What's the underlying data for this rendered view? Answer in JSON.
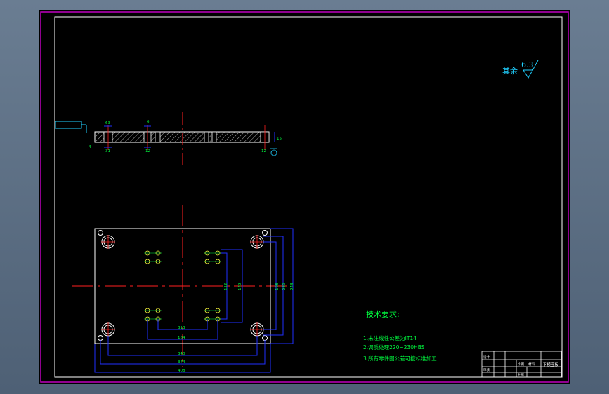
{
  "drawing": {
    "roughness": {
      "label": "其余",
      "value": "6.3"
    },
    "tech_req": {
      "title": "技术要求:",
      "items": [
        "1.未注线性公差为IT14",
        "2.调质处理220~230HBS",
        "3.所有零件图公差可按标准加工"
      ]
    },
    "section_dims": {
      "top_left": "63",
      "bottom_left": "31",
      "left_small": "4",
      "hole_top": "6",
      "hole_bottom": "12",
      "right_bottom": "12",
      "thickness": "15"
    },
    "plan_dims": {
      "inner_h1": "112",
      "inner_h2": "149",
      "outer_h1": "198",
      "outer_h2": "230",
      "outer_h3": "248",
      "w1": "313",
      "w2": "184",
      "w3": "340",
      "w4": "374",
      "w5": "408"
    },
    "title_block": {
      "name": "下模座板",
      "scale_label": "比例",
      "material_label": "材料",
      "sheet_label": "共张",
      "designer_label": "设计",
      "checker_label": "审核"
    },
    "colors": {
      "frame": "#c000c0",
      "outline": "#ffffff",
      "center": "#ff2020",
      "dimension": "#2030ff",
      "dim_text": "#00ff40",
      "hatch": "#ffffff",
      "text": "#20d0ff",
      "hole": "#ffff40"
    }
  }
}
